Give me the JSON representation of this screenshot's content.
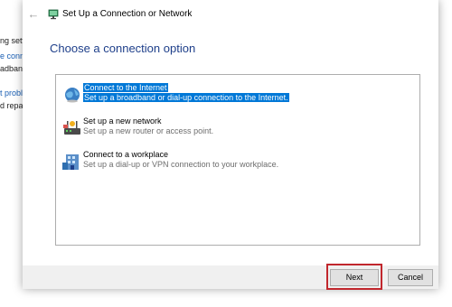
{
  "background": {
    "fragments": [
      {
        "text": "ng sett",
        "kind": "plain"
      },
      {
        "text": "e conn",
        "kind": "link"
      },
      {
        "text": "adband",
        "kind": "plain"
      },
      {
        "text": "t probl",
        "kind": "link"
      },
      {
        "text": "d repa",
        "kind": "plain"
      }
    ]
  },
  "dialog": {
    "title": "Set Up a Connection or Network",
    "heading": "Choose a connection option",
    "options": [
      {
        "title": "Connect to the Internet",
        "description": "Set up a broadband or dial-up connection to the Internet.",
        "icon": "globe-icon",
        "selected": true
      },
      {
        "title": "Set up a new network",
        "description": "Set up a new router or access point.",
        "icon": "router-icon",
        "selected": false
      },
      {
        "title": "Connect to a workplace",
        "description": "Set up a dial-up or VPN connection to your workplace.",
        "icon": "workplace-icon",
        "selected": false
      }
    ],
    "buttons": {
      "next": "Next",
      "cancel": "Cancel"
    }
  },
  "colors": {
    "selection": "#0078d7",
    "heading": "#1e3f8a",
    "highlight_box": "#c1272d"
  }
}
